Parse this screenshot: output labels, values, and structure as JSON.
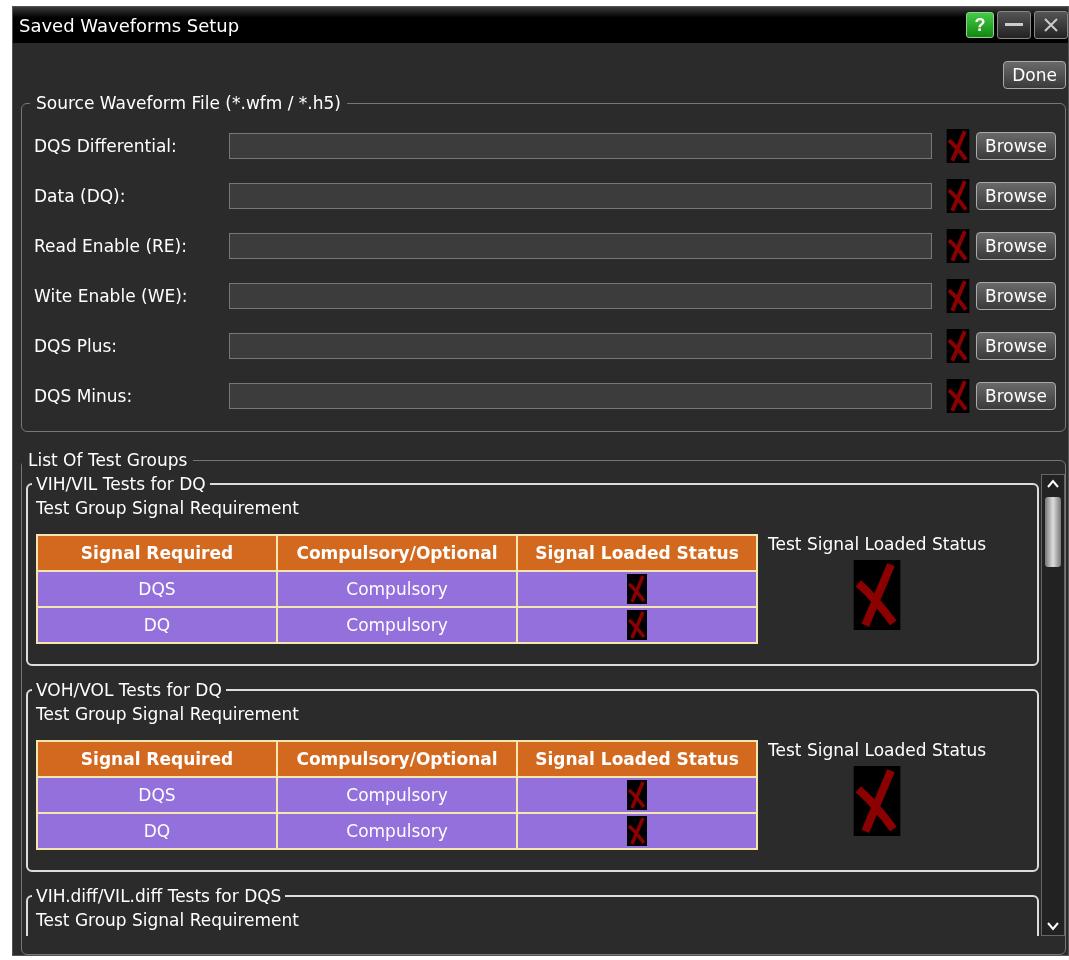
{
  "window": {
    "title": "Saved Waveforms Setup",
    "help": "?"
  },
  "done_button": "Done",
  "source": {
    "legend": "Source Waveform File (*.wfm / *.h5)",
    "files": [
      {
        "label": "DQS Differential:",
        "loaded": false,
        "button": "Browse"
      },
      {
        "label": "Data (DQ):",
        "loaded": false,
        "button": "Browse"
      },
      {
        "label": "Read Enable (RE):",
        "loaded": false,
        "button": "Browse"
      },
      {
        "label": "Wite Enable (WE):",
        "loaded": false,
        "button": "Browse"
      },
      {
        "label": "DQS Plus:",
        "loaded": false,
        "button": "Browse"
      },
      {
        "label": "DQS Minus:",
        "loaded": false,
        "button": "Browse"
      }
    ]
  },
  "test_groups": {
    "legend": "List Of Test Groups",
    "groups": [
      {
        "title": "VIH/VIL Tests for DQ",
        "subtitle": "Test Group Signal Requirement",
        "columns": [
          "Signal Required",
          "Compulsory/Optional",
          "Signal Loaded Status"
        ],
        "status_label": "Test Signal Loaded Status",
        "loaded": false,
        "rows": [
          {
            "signal": "DQS",
            "requirement": "Compulsory",
            "loaded": false
          },
          {
            "signal": "DQ",
            "requirement": "Compulsory",
            "loaded": false
          }
        ]
      },
      {
        "title": "VOH/VOL Tests for DQ",
        "subtitle": "Test Group Signal Requirement",
        "columns": [
          "Signal Required",
          "Compulsory/Optional",
          "Signal Loaded Status"
        ],
        "status_label": "Test Signal Loaded Status",
        "loaded": false,
        "rows": [
          {
            "signal": "DQS",
            "requirement": "Compulsory",
            "loaded": false
          },
          {
            "signal": "DQ",
            "requirement": "Compulsory",
            "loaded": false
          }
        ]
      },
      {
        "title": "VIH.diff/VIL.diff Tests for DQS",
        "subtitle": "Test Group Signal Requirement"
      }
    ]
  }
}
